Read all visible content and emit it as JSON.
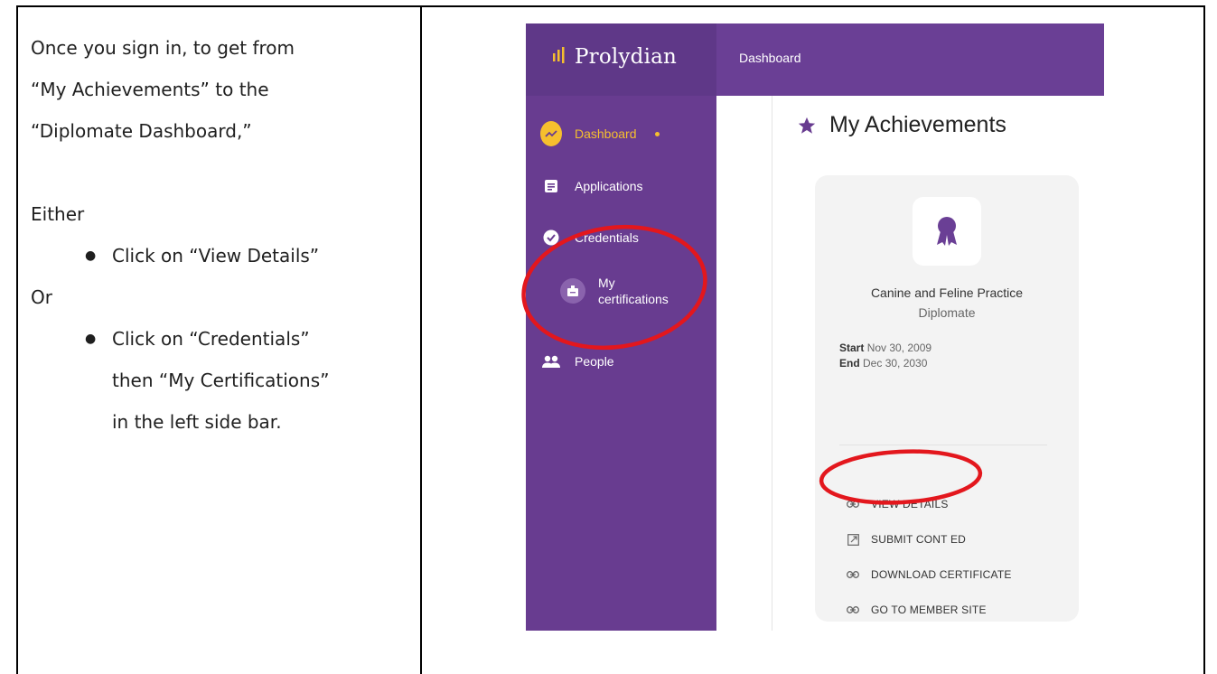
{
  "instructions": {
    "line1": "Once you sign in, to get from",
    "line2": "“My Achievements” to the",
    "line3": "“Diplomate Dashboard,”",
    "either": "Either",
    "bullet1": "Click on “View Details”",
    "or": "Or",
    "bullet2_line1": "Click on “Credentials”",
    "bullet2_line2": "then “My Certifications”",
    "bullet2_line3": "in the left side bar."
  },
  "app": {
    "brand": "Prolydian",
    "topbar_title": "Dashboard",
    "colors": {
      "brand_purple": "#683c90",
      "accent_yellow": "#f6bf2e",
      "annotation_red": "#e3171d"
    }
  },
  "sidebar": {
    "items": [
      {
        "label": "Dashboard",
        "icon": "trending-up-icon",
        "active": true
      },
      {
        "label": "Applications",
        "icon": "document-icon"
      },
      {
        "label": "Credentials",
        "icon": "verified-badge-icon"
      },
      {
        "label": "My certifications",
        "line1": "My",
        "line2": "certifications",
        "icon": "id-badge-icon"
      },
      {
        "label": "People",
        "icon": "people-icon"
      }
    ]
  },
  "main": {
    "heading": "My Achievements",
    "heading_icon": "star-icon",
    "card": {
      "badge_icon": "award-ribbon-icon",
      "title": "Canine and Feline Practice",
      "subtitle": "Diplomate",
      "start_label": "Start",
      "start_date": "Nov 30, 2009",
      "end_label": "End",
      "end_date": "Dec 30, 2030",
      "actions": [
        {
          "label": "VIEW DETAILS",
          "icon": "link-icon"
        },
        {
          "label": "SUBMIT CONT ED",
          "icon": "open-external-icon"
        },
        {
          "label": "DOWNLOAD CERTIFICATE",
          "icon": "link-icon"
        },
        {
          "label": "GO TO MEMBER SITE",
          "icon": "link-icon"
        }
      ]
    }
  }
}
